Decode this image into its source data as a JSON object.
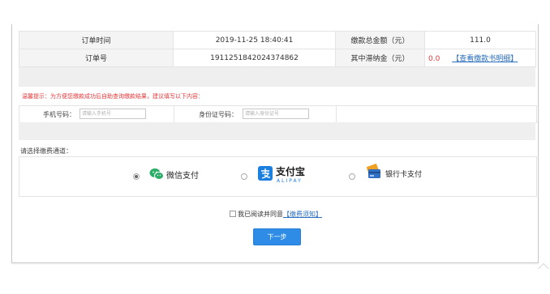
{
  "order": {
    "time_label": "订单时间",
    "time_value": "2019-11-25 18:40:41",
    "total_label": "缴款总金额（元）",
    "total_value": "111.0",
    "number_label": "订单号",
    "number_value": "1911251842024374862",
    "late_label": "其中滞纳金（元）",
    "late_value": "0.0",
    "detail_link": "【查看缴款书明细】"
  },
  "tip": "温馨提示：为方便您缴款成功后自助查询缴款结果，建议填写以下内容：",
  "form": {
    "phone_label": "手机号码：",
    "phone_placeholder": "请输入手机号",
    "id_label": "身份证号码：",
    "id_placeholder": "请输入身份证号"
  },
  "payment": {
    "title": "请选择缴费通道：",
    "options": [
      {
        "label": "微信支付",
        "icon": "wechat-icon",
        "selected": true
      },
      {
        "label": "支付宝",
        "sub": "ALIPAY",
        "icon": "alipay-icon",
        "selected": false
      },
      {
        "label": "银行卡支付",
        "icon": "bank-card-icon",
        "selected": false
      }
    ]
  },
  "agree": {
    "text": "我已阅读并同意",
    "link": "【缴费须知】"
  },
  "next_button": "下一步",
  "colors": {
    "accent": "#2e8ce6",
    "amount_red": "#e4393c",
    "link_blue": "#2a6ebd",
    "wechat_green": "#2aae67",
    "alipay_blue": "#1b7fe0"
  }
}
